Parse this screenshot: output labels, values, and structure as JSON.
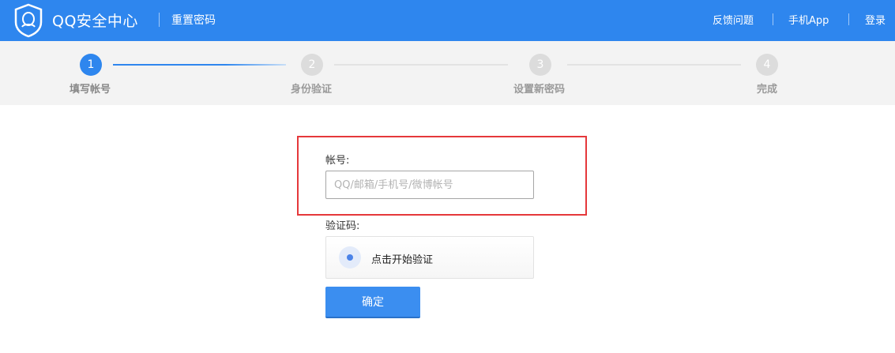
{
  "header": {
    "brand": "QQ安全中心",
    "subtitle": "重置密码",
    "links": {
      "feedback": "反馈问题",
      "mobile_app": "手机App",
      "login": "登录"
    },
    "background_color": "#2e86ee",
    "logo_icon": "qq-shield-logo"
  },
  "steps": [
    {
      "number": "1",
      "label": "填写帐号",
      "state": "active"
    },
    {
      "number": "2",
      "label": "身份验证",
      "state": "pending"
    },
    {
      "number": "3",
      "label": "设置新密码",
      "state": "pending"
    },
    {
      "number": "4",
      "label": "完成",
      "state": "pending"
    }
  ],
  "form": {
    "account_label": "帐号:",
    "account_value": "",
    "account_placeholder": "QQ/邮箱/手机号/微博帐号",
    "captcha_label": "验证码:",
    "captcha_prompt": "点击开始验证",
    "submit_label": "确定",
    "highlight_color": "#e5383b",
    "accent_color": "#3b8ef0"
  }
}
